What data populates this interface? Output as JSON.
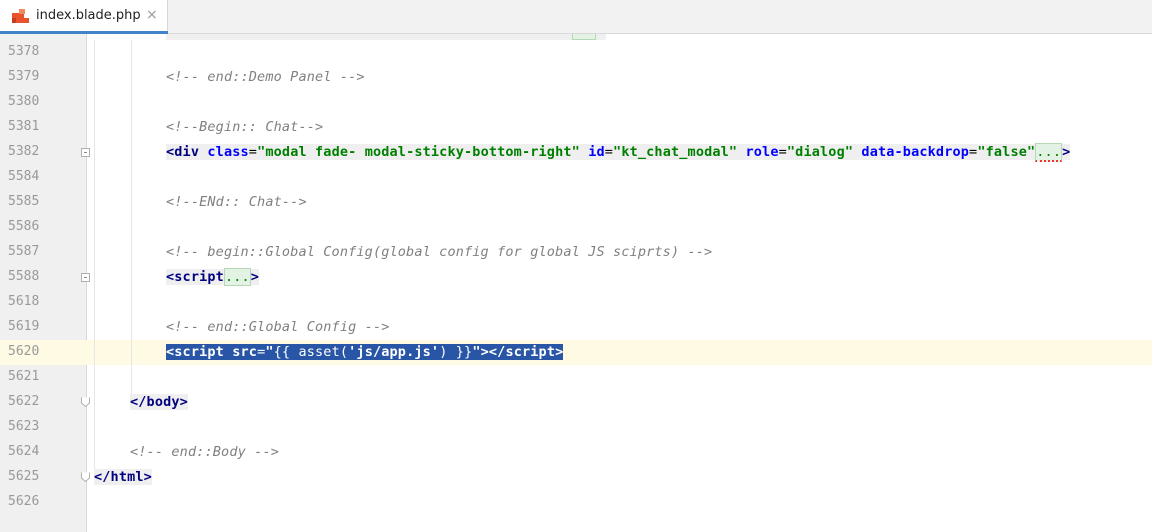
{
  "tab": {
    "filename": "index.blade.php",
    "close_glyph": "×",
    "icon": "laravel-icon"
  },
  "colors": {
    "comment": "#808080",
    "tag": "#000080",
    "attribute": "#0000ff",
    "string": "#008000",
    "selection": "#2855a5",
    "current_line": "#fffae3"
  },
  "editor": {
    "current_line": "5620",
    "lines": [
      {
        "num": "5378"
      },
      {
        "num": "5379",
        "comment": "<!-- end::Demo Panel -->"
      },
      {
        "num": "5380"
      },
      {
        "num": "5381",
        "comment": "<!--Begin:: Chat-->"
      },
      {
        "num": "5382",
        "open": "<div",
        "a1": "class",
        "v1": "\"modal fade- modal-sticky-bottom-right\"",
        "a2": "id",
        "v2": "\"kt_chat_modal\"",
        "a3": "role",
        "v3": "\"dialog\"",
        "a4": "data-backdrop",
        "v4": "\"false\"",
        "dots": "...",
        "close": ">"
      },
      {
        "num": "5584"
      },
      {
        "num": "5585",
        "comment": "<!--ENd:: Chat-->"
      },
      {
        "num": "5586"
      },
      {
        "num": "5587",
        "comment": "<!-- begin::Global Config(global config for global JS sciprts) -->"
      },
      {
        "num": "5588",
        "open": "<script",
        "dots": "...",
        "close": ">"
      },
      {
        "num": "5618"
      },
      {
        "num": "5619",
        "comment": "<!-- end::Global Config -->"
      },
      {
        "num": "5620",
        "open": "<script",
        "a1": "src",
        "eq": "=",
        "q1": "\"",
        "blade": "{{ asset(",
        "jsarg": "'js/app.js'",
        "blade_end": ") }}",
        "q2": "\"",
        "gt": ">",
        "closetag": "</script",
        "end": ">"
      },
      {
        "num": "5621"
      },
      {
        "num": "5622",
        "text": "</body>"
      },
      {
        "num": "5623"
      },
      {
        "num": "5624",
        "comment": "<!-- end::Body -->"
      },
      {
        "num": "5625",
        "text": "</html>"
      },
      {
        "num": "5626"
      }
    ]
  }
}
